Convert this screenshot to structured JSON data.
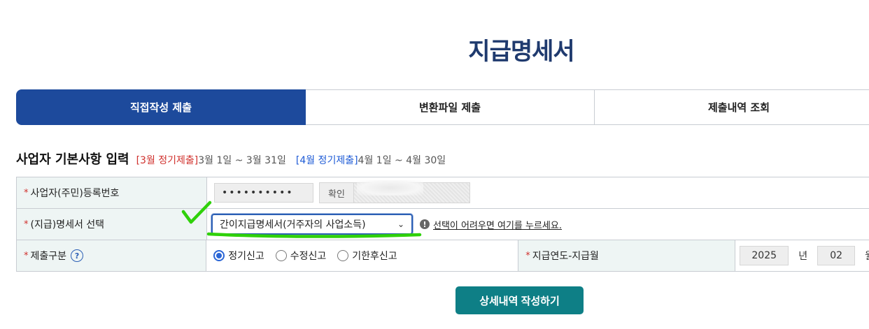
{
  "page": {
    "title": "지급명세서"
  },
  "tabs": [
    {
      "label": "직접작성 제출",
      "active": true
    },
    {
      "label": "변환파일 제출",
      "active": false
    },
    {
      "label": "제출내역 조회",
      "active": false
    }
  ],
  "section": {
    "title": "사업자 기본사항 입력",
    "periods": [
      {
        "tag": "[3월 정기제출]",
        "range": "3월 1일 ~ 3월 31일",
        "color": "#d0312d"
      },
      {
        "tag": "[4월 정기제출]",
        "range": "4월 1일 ~ 4월 30일",
        "color": "#1e5bd6"
      }
    ]
  },
  "form": {
    "required_mark": "*",
    "registration": {
      "label": "사업자(주민)등록번호",
      "masked_value": "••••••••••",
      "confirm_label": "확인"
    },
    "statement_select": {
      "label": "(지급)명세서 선택",
      "selected": "간이지급명세서(거주자의 사업소득)",
      "help_text_link": "선택이 어려우면 여기를 누르세요.",
      "help_icon": "exclamation-circle-icon"
    },
    "submit_type": {
      "label": "제출구분",
      "help_icon": "?",
      "options": [
        {
          "label": "정기신고",
          "checked": true
        },
        {
          "label": "수정신고",
          "checked": false
        },
        {
          "label": "기한후신고",
          "checked": false
        }
      ]
    },
    "pay_period": {
      "label": "지급연도-지급월",
      "year": "2025",
      "year_unit": "년",
      "month": "02",
      "month_unit": "월"
    }
  },
  "actions": {
    "primary_label": "상세내역 작성하기"
  },
  "colors": {
    "brand_navy": "#1d4a9c",
    "teal_button": "#0e7f86",
    "annotation_green": "#2fd10a"
  }
}
